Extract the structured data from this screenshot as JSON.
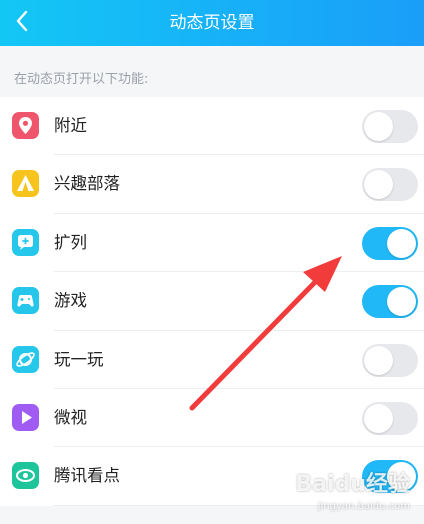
{
  "header": {
    "title": "动态页设置"
  },
  "section": {
    "label": "在动态页打开以下功能:"
  },
  "items": [
    {
      "label": "附近",
      "icon": "location-pin-icon",
      "icon_color": "#f0566b",
      "enabled": false
    },
    {
      "label": "兴趣部落",
      "icon": "tent-icon",
      "icon_color": "#f7c41d",
      "enabled": false
    },
    {
      "label": "扩列",
      "icon": "chat-plus-icon",
      "icon_color": "#25c7ea",
      "enabled": true
    },
    {
      "label": "游戏",
      "icon": "gamepad-icon",
      "icon_color": "#26c5ea",
      "enabled": true
    },
    {
      "label": "玩一玩",
      "icon": "planet-icon",
      "icon_color": "#25c7ea",
      "enabled": false
    },
    {
      "label": "微视",
      "icon": "play-icon",
      "icon_color": "#a05bf3",
      "enabled": false
    },
    {
      "label": "腾讯看点",
      "icon": "eye-icon",
      "icon_color": "#1fc59a",
      "enabled": true
    }
  ],
  "watermark": {
    "text": "Baidu经验",
    "sub": "jingyan.baidu.com"
  },
  "colors": {
    "header_start": "#13c7f5",
    "header_end": "#1a9ef8",
    "toggle_on": "#20b8f6",
    "toggle_off": "#e7e8ec",
    "arrow": "#f23c3c"
  }
}
